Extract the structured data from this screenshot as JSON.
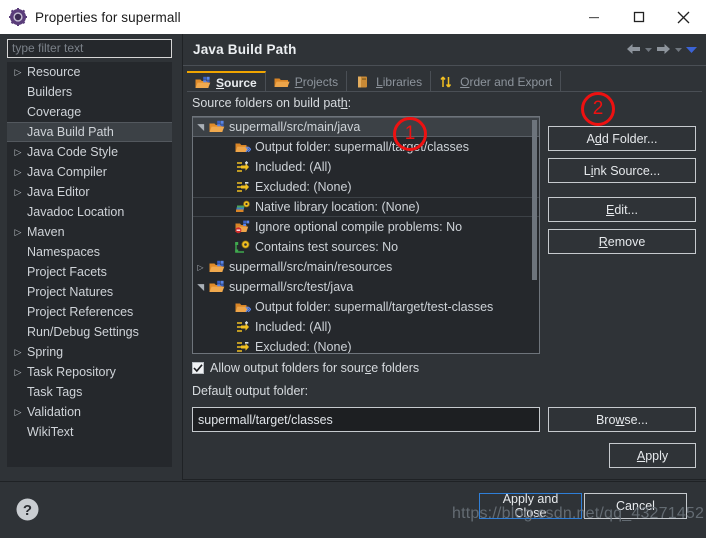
{
  "window": {
    "title": "Properties for supermall",
    "icon": "eclipse-properties-icon",
    "minimize_label": "—",
    "maximize_label": "□",
    "close_label": "✕"
  },
  "sidebar": {
    "filter": {
      "value": "",
      "placeholder": "type filter text"
    },
    "items": [
      {
        "label": "Resource",
        "expandable": true,
        "selected": false
      },
      {
        "label": "Builders",
        "expandable": false,
        "selected": false
      },
      {
        "label": "Coverage",
        "expandable": false,
        "selected": false
      },
      {
        "label": "Java Build Path",
        "expandable": false,
        "selected": true
      },
      {
        "label": "Java Code Style",
        "expandable": true,
        "selected": false
      },
      {
        "label": "Java Compiler",
        "expandable": true,
        "selected": false
      },
      {
        "label": "Java Editor",
        "expandable": true,
        "selected": false
      },
      {
        "label": "Javadoc Location",
        "expandable": false,
        "selected": false
      },
      {
        "label": "Maven",
        "expandable": true,
        "selected": false
      },
      {
        "label": "Namespaces",
        "expandable": false,
        "selected": false
      },
      {
        "label": "Project Facets",
        "expandable": false,
        "selected": false
      },
      {
        "label": "Project Natures",
        "expandable": false,
        "selected": false
      },
      {
        "label": "Project References",
        "expandable": false,
        "selected": false
      },
      {
        "label": "Run/Debug Settings",
        "expandable": false,
        "selected": false
      },
      {
        "label": "Spring",
        "expandable": true,
        "selected": false
      },
      {
        "label": "Task Repository",
        "expandable": true,
        "selected": false
      },
      {
        "label": "Task Tags",
        "expandable": false,
        "selected": false
      },
      {
        "label": "Validation",
        "expandable": true,
        "selected": false
      },
      {
        "label": "WikiText",
        "expandable": false,
        "selected": false
      }
    ]
  },
  "panel": {
    "title": "Java Build Path",
    "nav": {
      "back_icon": "arrow-left-icon",
      "back_menu_icon": "chevron-down-icon",
      "forward_icon": "arrow-right-icon",
      "forward_menu_icon": "chevron-down-icon",
      "view_menu_icon": "chevron-down-blue-icon"
    },
    "tabs": [
      {
        "label": "Source",
        "mnemonic": "S",
        "icon": "source-folder-icon",
        "active": true
      },
      {
        "label": "Projects",
        "mnemonic": "P",
        "icon": "projects-icon",
        "active": false
      },
      {
        "label": "Libraries",
        "mnemonic": "L",
        "icon": "library-icon",
        "active": false
      },
      {
        "label": "Order and Export",
        "mnemonic": "O",
        "icon": "order-export-icon",
        "active": false
      }
    ],
    "caption": "Source folders on build path:",
    "caption_mnemonic": "h",
    "tree": [
      {
        "text": "supermall/src/main/java",
        "icon": "source-folder-icon",
        "level": 0,
        "twisty": "expanded",
        "selected": true
      },
      {
        "text": "Output folder: supermall/target/classes",
        "icon": "output-folder-icon",
        "level": 1,
        "twisty": "none",
        "selected": false
      },
      {
        "text": "Included: (All)",
        "icon": "included-icon",
        "level": 1,
        "twisty": "none",
        "selected": false
      },
      {
        "text": "Excluded: (None)",
        "icon": "excluded-icon",
        "level": 1,
        "twisty": "none",
        "selected": false
      },
      {
        "text": "Native library location: (None)",
        "icon": "native-library-icon",
        "level": 1,
        "twisty": "none",
        "selected": false,
        "rowline": true
      },
      {
        "text": "Ignore optional compile problems: No",
        "icon": "ignore-problems-icon",
        "level": 1,
        "twisty": "none",
        "selected": false
      },
      {
        "text": "Contains test sources: No",
        "icon": "test-sources-icon",
        "level": 1,
        "twisty": "none",
        "selected": false
      },
      {
        "text": "supermall/src/main/resources",
        "icon": "source-folder-icon",
        "level": 0,
        "twisty": "collapsed",
        "selected": false
      },
      {
        "text": "supermall/src/test/java",
        "icon": "source-folder-icon",
        "level": 0,
        "twisty": "expanded",
        "selected": false
      },
      {
        "text": "Output folder: supermall/target/test-classes",
        "icon": "output-folder-icon",
        "level": 1,
        "twisty": "none",
        "selected": false
      },
      {
        "text": "Included: (All)",
        "icon": "included-icon",
        "level": 1,
        "twisty": "none",
        "selected": false
      },
      {
        "text": "Excluded: (None)",
        "icon": "excluded-icon",
        "level": 1,
        "twisty": "none",
        "selected": false
      }
    ],
    "buttons": {
      "add_folder": {
        "label": "Add Folder...",
        "mnemonic": "d"
      },
      "link_source": {
        "label": "Link Source...",
        "mnemonic": "i"
      },
      "edit": {
        "label": "Edit...",
        "mnemonic": "E"
      },
      "remove": {
        "label": "Remove",
        "mnemonic": "R"
      },
      "browse": {
        "label": "Browse...",
        "mnemonic": "w"
      },
      "apply": {
        "label": "Apply",
        "mnemonic": "A"
      }
    },
    "allow_output_folders": {
      "label": "Allow output folders for source folders",
      "checked": true
    },
    "default_output_label": "Default output folder:",
    "default_output_value": "supermall/target/classes"
  },
  "footer": {
    "help_icon": "help-question-icon",
    "apply_and_close": "Apply and Close",
    "cancel": "Cancel"
  },
  "annotations": [
    {
      "id": "1",
      "label": "1"
    },
    {
      "id": "2",
      "label": "2"
    }
  ],
  "watermark": "https://blog.csdn.net/qq_43271452",
  "colors": {
    "accent_tab": "#f0a500",
    "focus_border": "#2f7fd8",
    "annotation": "#ee1111",
    "panel_bg": "#2f3337",
    "field_bg": "#25282c"
  }
}
